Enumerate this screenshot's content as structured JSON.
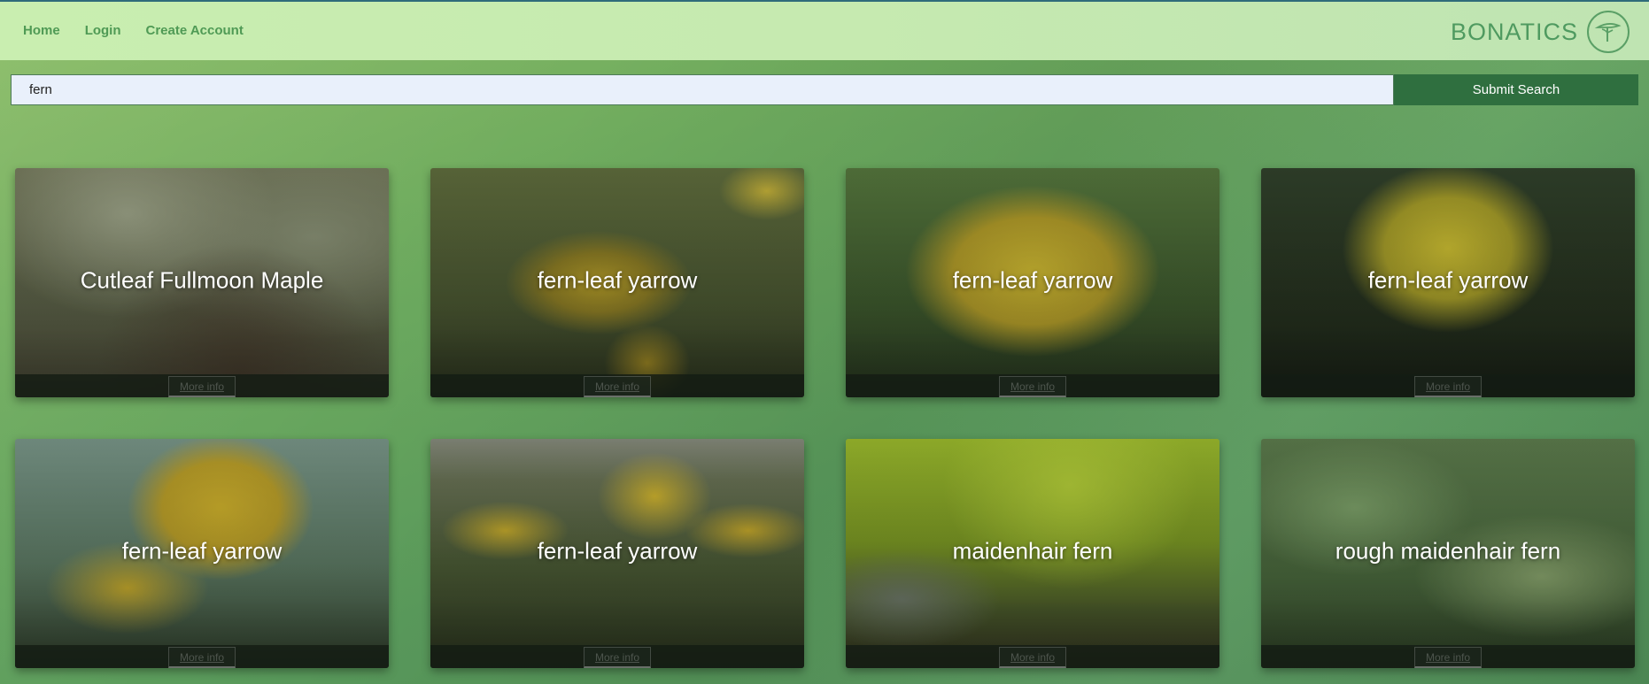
{
  "nav": {
    "links": [
      {
        "label": "Home"
      },
      {
        "label": "Login"
      },
      {
        "label": "Create Account"
      }
    ],
    "brand": "BONATICS",
    "logo_icon": "tree-icon",
    "line_color": "#2f6b7a"
  },
  "search": {
    "value": "fern",
    "placeholder": "",
    "submit_label": "Submit Search"
  },
  "more_label": "More info",
  "cards": [
    {
      "title": "Cutleaf Fullmoon Maple",
      "image": "maple-tree-canopy",
      "palette": [
        "#6a6e4e",
        "#4a5238",
        "#7b8560"
      ]
    },
    {
      "title": "fern-leaf yarrow",
      "image": "yellow-yarrow-flowers",
      "palette": [
        "#5a6a3a",
        "#3e4a2a",
        "#b5a231"
      ]
    },
    {
      "title": "fern-leaf yarrow",
      "image": "yellow-yarrow-cluster",
      "palette": [
        "#4f6e3a",
        "#33452a",
        "#c8b530"
      ]
    },
    {
      "title": "fern-leaf yarrow",
      "image": "yellow-yarrow-dark-bg",
      "palette": [
        "#2f3d28",
        "#1f2a1c",
        "#c4b82e"
      ]
    },
    {
      "title": "fern-leaf yarrow",
      "image": "yarrow-silver-foliage",
      "palette": [
        "#6f8a7a",
        "#4f6a58",
        "#c6b02f"
      ]
    },
    {
      "title": "fern-leaf yarrow",
      "image": "yarrow-garden-bed",
      "palette": [
        "#5e6c4c",
        "#3f4f33",
        "#c8ab2c"
      ]
    },
    {
      "title": "maidenhair fern",
      "image": "maidenhair-fern-fronds",
      "palette": [
        "#8fae2a",
        "#5a7a20",
        "#3d4a2a"
      ]
    },
    {
      "title": "rough maidenhair fern",
      "image": "rough-maidenhair-leaves",
      "palette": [
        "#5f7f4f",
        "#3f5c36",
        "#8aa66e"
      ]
    }
  ]
}
